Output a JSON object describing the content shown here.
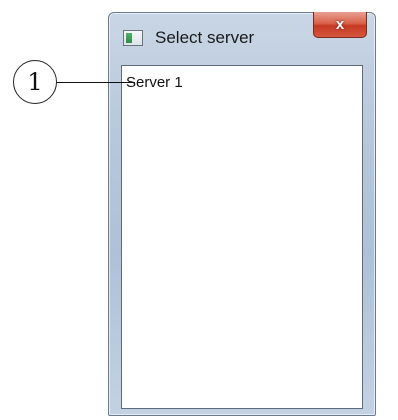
{
  "window": {
    "title": "Select server",
    "close_label": "x"
  },
  "server_list": {
    "items": [
      {
        "label": "Server 1"
      }
    ]
  },
  "callout": {
    "number": "1"
  }
}
